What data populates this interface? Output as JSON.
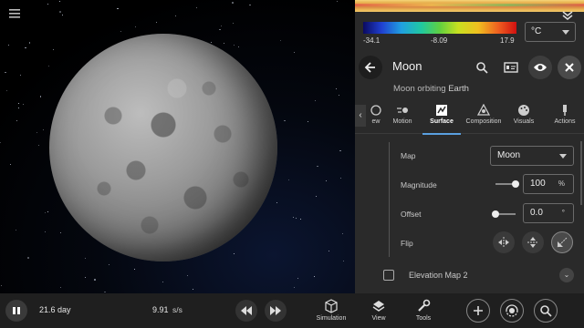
{
  "viewport": {
    "menu_icon": "hamburger-icon"
  },
  "panel": {
    "colorbar": {
      "min": "-34.1",
      "mid": "-8.09",
      "max": "17.9"
    },
    "unit_select": "°C",
    "title": "Moon",
    "subtitle_prefix": "Moon orbiting ",
    "subtitle_parent": "Earth",
    "tabs": [
      {
        "label": "ew",
        "icon": "globe-icon"
      },
      {
        "label": "Motion",
        "icon": "motion-icon"
      },
      {
        "label": "Surface",
        "icon": "surface-icon",
        "active": true
      },
      {
        "label": "Composition",
        "icon": "composition-icon"
      },
      {
        "label": "Visuals",
        "icon": "palette-icon"
      },
      {
        "label": "Actions",
        "icon": "actions-icon"
      }
    ],
    "surface": {
      "map_label": "Map",
      "map_value": "Moon",
      "magnitude_label": "Magnitude",
      "magnitude_value": "100",
      "magnitude_unit": "%",
      "magnitude_level": 1.0,
      "offset_label": "Offset",
      "offset_value": "0.0",
      "offset_unit": "°",
      "offset_level": 0.0,
      "flip_label": "Flip",
      "elevation_label": "Elevation Map 2"
    }
  },
  "bottom_bar": {
    "time": "21.6 day",
    "rate_value": "9.91",
    "rate_unit": "s/s",
    "tools": [
      {
        "label": "Simulation",
        "icon": "cube-icon"
      },
      {
        "label": "View",
        "icon": "layers-icon"
      },
      {
        "label": "Tools",
        "icon": "wrench-icon"
      }
    ]
  }
}
